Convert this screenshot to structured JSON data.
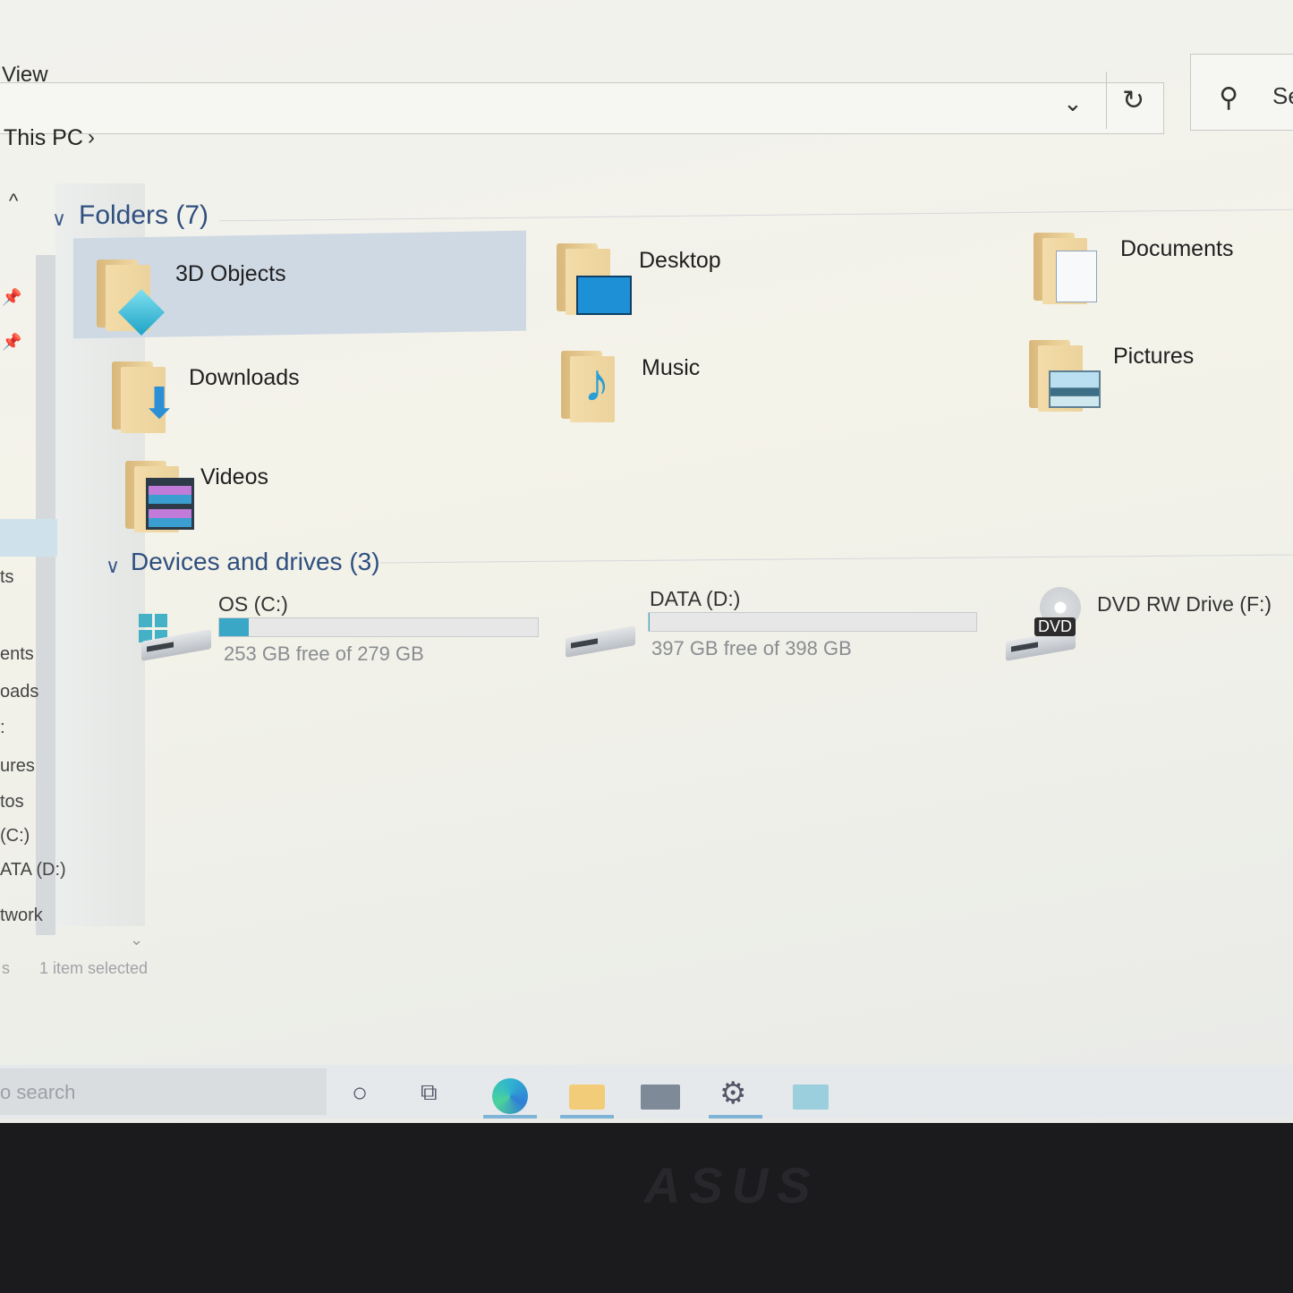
{
  "ribbon": {
    "view_tab": "View"
  },
  "address": {
    "breadcrumb": "This PC",
    "chevron": "›",
    "dropdown": "⌄",
    "refresh": "↻"
  },
  "search": {
    "placeholder": "Se"
  },
  "nav": {
    "items": [
      "ts",
      "ents",
      "oads",
      ":",
      "ures",
      "tos",
      "(C:)",
      "ATA (D:)",
      "twork"
    ]
  },
  "folders_group": {
    "title": "Folders (7)",
    "items": [
      {
        "label": "3D Objects",
        "selected": true,
        "overlay_icon": "3d-cube-icon"
      },
      {
        "label": "Desktop",
        "overlay_icon": "monitor-icon"
      },
      {
        "label": "Documents",
        "overlay_icon": "document-icon"
      },
      {
        "label": "Downloads",
        "overlay_icon": "down-arrow-icon"
      },
      {
        "label": "Music",
        "overlay_icon": "music-note-icon"
      },
      {
        "label": "Pictures",
        "overlay_icon": "landscape-icon"
      },
      {
        "label": "Videos",
        "overlay_icon": "film-icon"
      }
    ]
  },
  "drives_group": {
    "title": "Devices and drives (3)",
    "items": [
      {
        "label": "OS (C:)",
        "free_text": "253 GB free of 279 GB",
        "used_fraction": 0.093
      },
      {
        "label": "DATA (D:)",
        "free_text": "397 GB free of 398 GB",
        "used_fraction": 0.0025
      },
      {
        "label": "DVD RW Drive (F:)",
        "badge": "DVD"
      }
    ]
  },
  "status_bar": {
    "items_count": "s",
    "selection": "1 item selected"
  },
  "taskbar": {
    "search_text": "o search",
    "icons": [
      "cortana-circle-icon",
      "task-view-icon",
      "edge-icon",
      "file-explorer-icon",
      "mail-icon",
      "settings-gear-icon",
      "photos-icon"
    ]
  },
  "colors": {
    "accent": "#3aa7c6",
    "selection": "#cfd9e4",
    "group_header": "#2f4f7f"
  },
  "bezel": {
    "brand": "ASUS"
  }
}
